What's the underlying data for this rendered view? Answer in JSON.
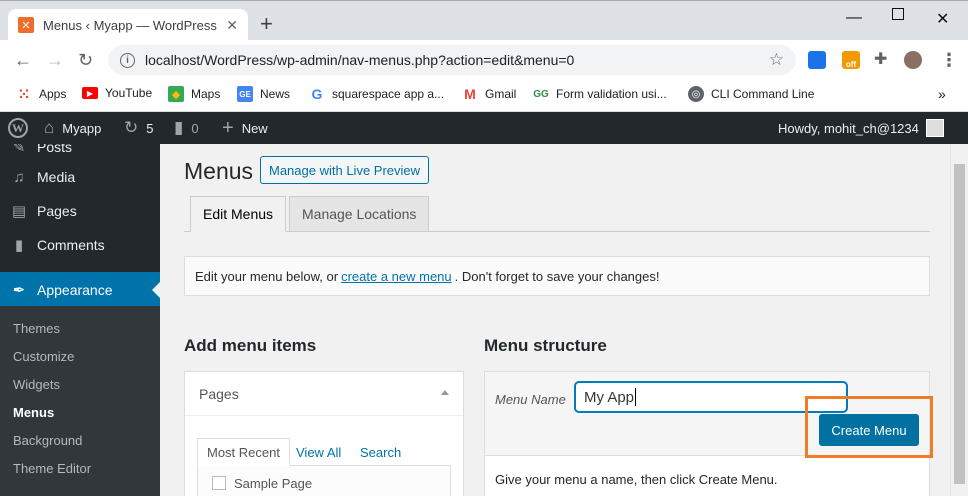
{
  "browser": {
    "tab_title": "Menus ‹ Myapp — WordPress",
    "tab_favicon": "xampp-icon",
    "url": "localhost/WordPress/wp-admin/nav-menus.php?action=edit&menu=0",
    "bookmarks": [
      {
        "label": "Apps",
        "icon": "apps-grid-icon",
        "color": "#4285f4"
      },
      {
        "label": "YouTube",
        "icon": "youtube-icon",
        "color": "#ff0000"
      },
      {
        "label": "Maps",
        "icon": "maps-icon",
        "color": "#34a853"
      },
      {
        "label": "News",
        "icon": "news-icon",
        "color": "#4285f4"
      },
      {
        "label": "squarespace app a...",
        "icon": "google-icon",
        "color": "#4285f4"
      },
      {
        "label": "Gmail",
        "icon": "gmail-icon",
        "color": "#ea4335"
      },
      {
        "label": "Form validation usi...",
        "icon": "geeksforgeeks-icon",
        "color": "#2f8d46"
      },
      {
        "label": "CLI Command Line",
        "icon": "globe-icon",
        "color": "#5f6368"
      }
    ],
    "ext_badge": "off"
  },
  "adminbar": {
    "site_name": "Myapp",
    "updates_count": "5",
    "comments_count": "0",
    "new_label": "New",
    "howdy": "Howdy, mohit_ch@1234"
  },
  "sidebar": {
    "top_partial": "Posts",
    "items": [
      {
        "label": "Media",
        "icon": "media-icon"
      },
      {
        "label": "Pages",
        "icon": "pages-icon"
      },
      {
        "label": "Comments",
        "icon": "comments-icon"
      }
    ],
    "current": {
      "label": "Appearance",
      "icon": "brush-icon"
    },
    "submenu": [
      "Themes",
      "Customize",
      "Widgets",
      "Menus",
      "Background",
      "Theme Editor"
    ],
    "submenu_current": "Menus"
  },
  "main": {
    "title": "Menus",
    "preview_button": "Manage with Live Preview",
    "tabs": [
      "Edit Menus",
      "Manage Locations"
    ],
    "notice_before": "Edit your menu below, or",
    "notice_link": "create a new menu",
    "notice_after": ". Don't forget to save your changes!",
    "add_items_heading": "Add menu items",
    "pages_panel": {
      "title": "Pages",
      "subtabs": [
        "Most Recent",
        "View All",
        "Search"
      ],
      "first_item": "Sample Page"
    },
    "structure_heading": "Menu structure",
    "menu_name_label": "Menu Name",
    "menu_name_value": "My App",
    "create_button": "Create Menu",
    "hint": "Give your menu a name, then click Create Menu."
  },
  "colors": {
    "wp_dark": "#23282d",
    "wp_blue": "#0073aa",
    "highlight_orange": "#f07c29"
  }
}
